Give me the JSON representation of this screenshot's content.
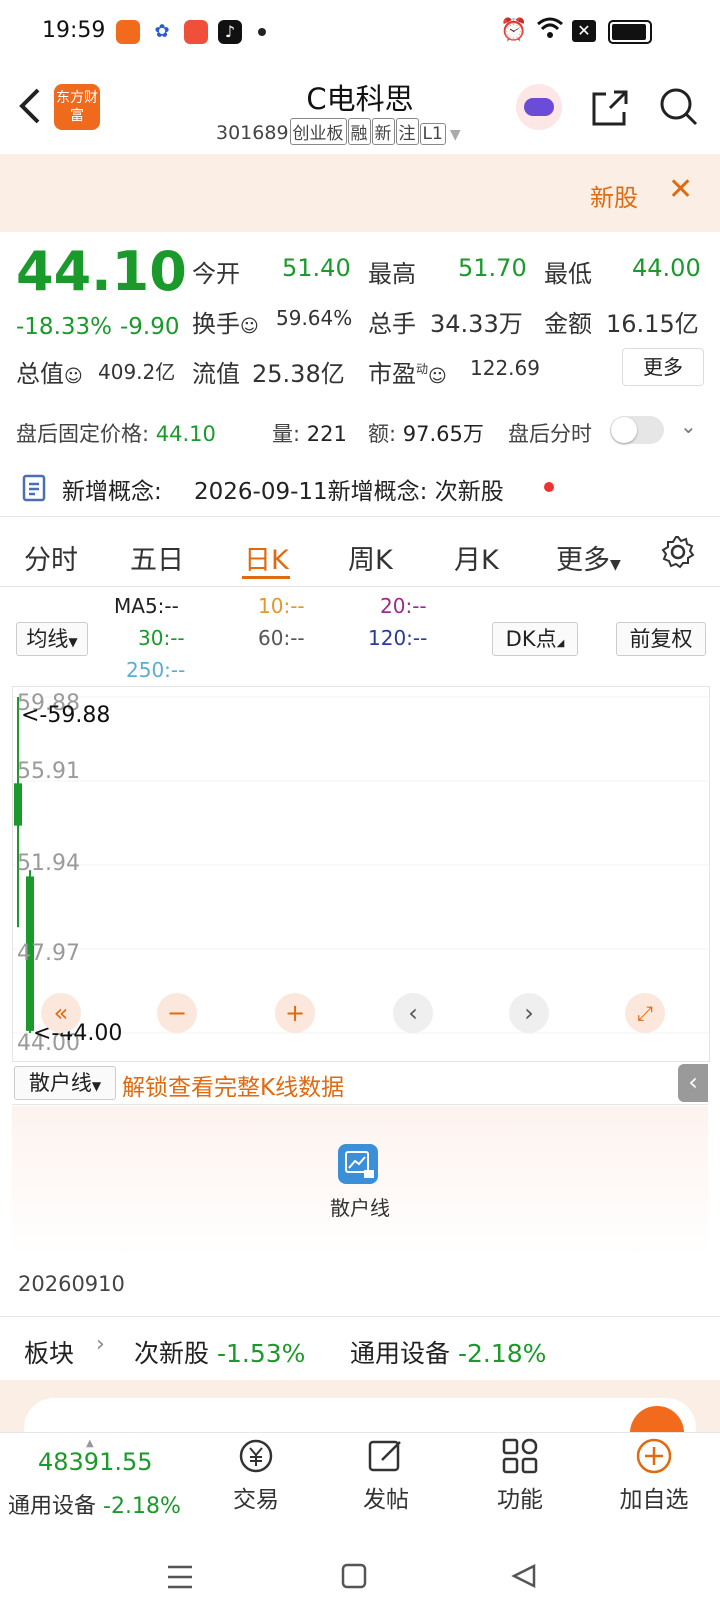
{
  "status_bar": {
    "time": "19:59",
    "icons": [
      "app-orange-icon",
      "baidu-icon",
      "app-red-icon",
      "tiktok-icon",
      "dot-icon",
      "alarm-icon",
      "wifi-icon",
      "sim-off-icon",
      "battery-icon"
    ]
  },
  "header": {
    "logo_text": "东方财富",
    "title": "C电科思",
    "code": "301689",
    "tags": [
      "创业板",
      "融",
      "新",
      "注",
      "L1"
    ]
  },
  "banner": {
    "label": "新股"
  },
  "quote": {
    "price": "44.10",
    "change_pct": "-18.33%",
    "change_abs": "-9.90",
    "open_label": "今开",
    "open": "51.40",
    "high_label": "最高",
    "high": "51.70",
    "low_label": "最低",
    "low": "44.00",
    "turnover_label": "换手",
    "turnover": "59.64%",
    "volume_label": "总手",
    "volume": "34.33万",
    "amount_label": "金额",
    "amount": "16.15亿",
    "mktcap_label": "总值",
    "mktcap": "409.2亿",
    "float_label": "流值",
    "float": "25.38亿",
    "pe_label": "市盈",
    "pe_sup": "动",
    "pe": "122.69",
    "more_label": "更多"
  },
  "afterhours": {
    "label": "盘后固定价格:",
    "price": "44.10",
    "vol_label": "量:",
    "vol": "221",
    "amt_label": "额:",
    "amt": "97.65万",
    "toggle_label": "盘后分时"
  },
  "concept": {
    "label": "新增概念:",
    "text": "2026-09-11新增概念: 次新股"
  },
  "tabs": [
    "分时",
    "五日",
    "日K",
    "周K",
    "月K",
    "更多"
  ],
  "active_tab": "日K",
  "ma": {
    "select_label": "均线",
    "ma5": "MA5:--",
    "ma10": "10:--",
    "ma20": "20:--",
    "ma30": "30:--",
    "ma60": "60:--",
    "ma120": "120:--",
    "ma250": "250:--",
    "dk_label": "DK点",
    "adj_label": "前复权"
  },
  "chart": {
    "y_ticks": [
      "59.88",
      "55.91",
      "51.94",
      "47.97",
      "44.00"
    ],
    "max_marker": "<-59.88",
    "min_marker": "<-44.00",
    "candles": [
      {
        "open": 53.8,
        "close": 55.8,
        "high": 59.88,
        "low": 49.0,
        "color": "#1a9a2a"
      },
      {
        "open": 51.4,
        "close": 44.1,
        "high": 51.7,
        "low": 44.0,
        "color": "#1a9a2a"
      }
    ],
    "y_range": [
      44.0,
      59.88
    ]
  },
  "indicator": {
    "select_label": "散户线",
    "unlock_text": "解锁查看完整K线数据",
    "panel_label": "散户线"
  },
  "date_label": "20260910",
  "sector": {
    "label": "板块",
    "item1_name": "次新股",
    "item1_pct": "-1.53%",
    "item2_name": "通用设备",
    "item2_pct": "-2.18%"
  },
  "bottom_nav": {
    "index_value": "48391.55",
    "index_name": "通用设备",
    "index_pct": "-2.18%",
    "items": [
      "交易",
      "发帖",
      "功能",
      "加自选"
    ]
  }
}
